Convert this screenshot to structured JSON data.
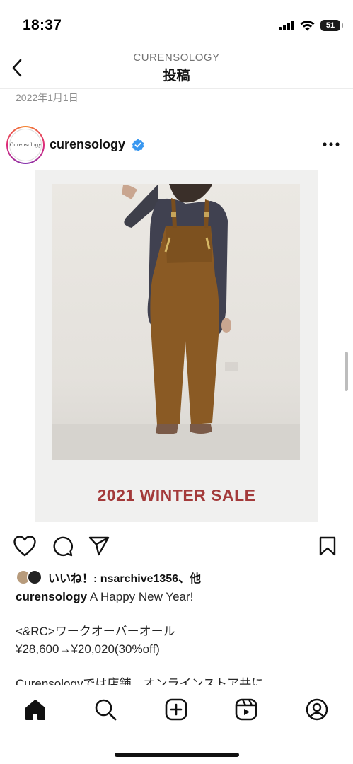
{
  "status_bar": {
    "time": "18:37",
    "battery": "51",
    "icons": [
      "signal-icon",
      "wifi-icon",
      "battery-icon"
    ]
  },
  "header": {
    "subtitle": "CURENSOLOGY",
    "title": "投稿",
    "back_icon": "chevron-left-icon"
  },
  "post": {
    "date": "2022年1月1日",
    "username": "curensology",
    "verified": true,
    "avatar_text": "Curensology",
    "image_caption_text": "2021 WINTER SALE",
    "likes_label": "いいね！: nsarchive1356、他",
    "caption": {
      "username": "curensology",
      "line1": " A Happy New Year!",
      "line2": "<&RC>ワークオーバーオール",
      "line3": "¥28,600→¥20,020(30%off)",
      "line4": "Curensologyでは店舗、オンラインストア共に"
    }
  },
  "actions": [
    "heart-icon",
    "comment-icon",
    "share-icon",
    "bookmark-icon"
  ],
  "tab_bar": [
    "home-icon",
    "search-icon",
    "create-icon",
    "reels-icon",
    "profile-icon"
  ],
  "colors": {
    "accent_verified": "#3897f0",
    "sale_text": "#a33a3a",
    "text": "#262626",
    "muted": "#8e8e8e"
  }
}
